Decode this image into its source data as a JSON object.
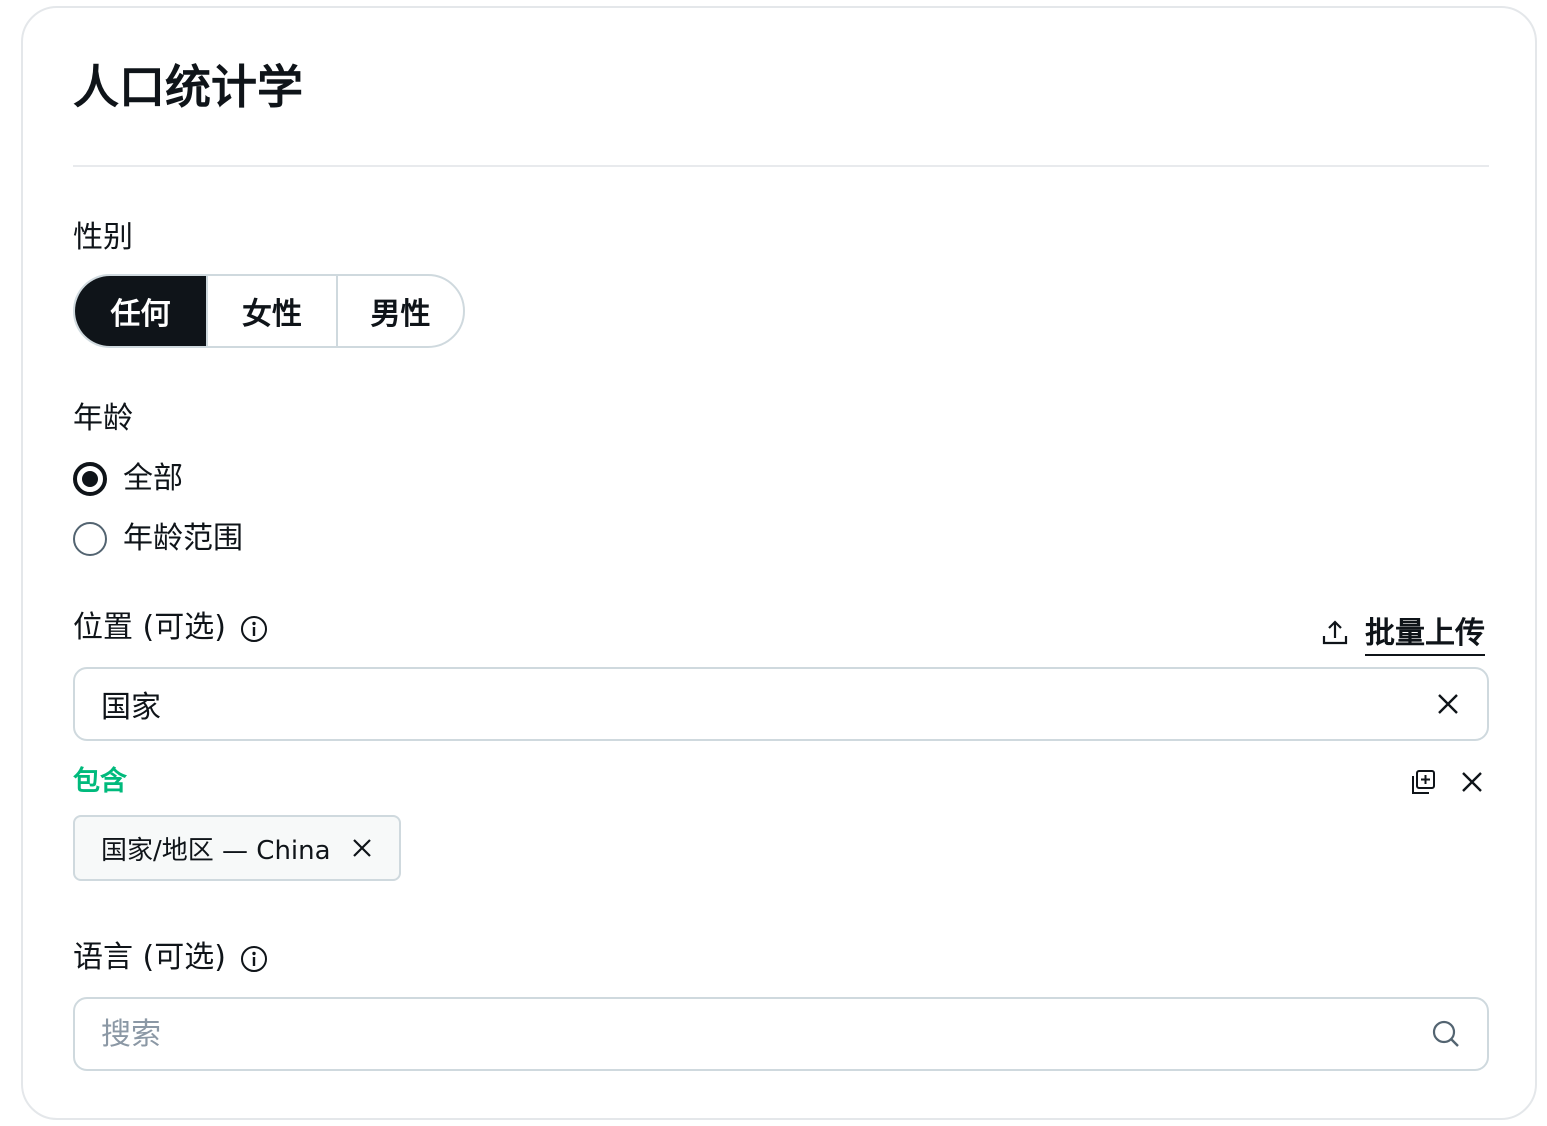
{
  "section": {
    "title": "人口统计学"
  },
  "gender": {
    "label": "性别",
    "options": [
      "任何",
      "女性",
      "男性"
    ],
    "selected": "任何"
  },
  "age": {
    "label": "年龄",
    "options": [
      {
        "label": "全部",
        "checked": true
      },
      {
        "label": "年龄范围",
        "checked": false
      }
    ]
  },
  "location": {
    "label": "位置 (可选)",
    "bulk_upload_label": "批量上传",
    "input_value": "国家",
    "include_label": "包含",
    "chips": [
      "国家/地区 — China"
    ]
  },
  "language": {
    "label": "语言 (可选)",
    "search_placeholder": "搜索"
  },
  "colors": {
    "primary": "#0f1419",
    "include_green": "#00ba7c",
    "border": "#cfd9de",
    "placeholder": "#8b98a5"
  },
  "icons": {
    "info": "info-icon",
    "upload": "upload-icon",
    "clear": "close-icon",
    "add_copy": "add-copy-icon",
    "search": "search-icon"
  }
}
